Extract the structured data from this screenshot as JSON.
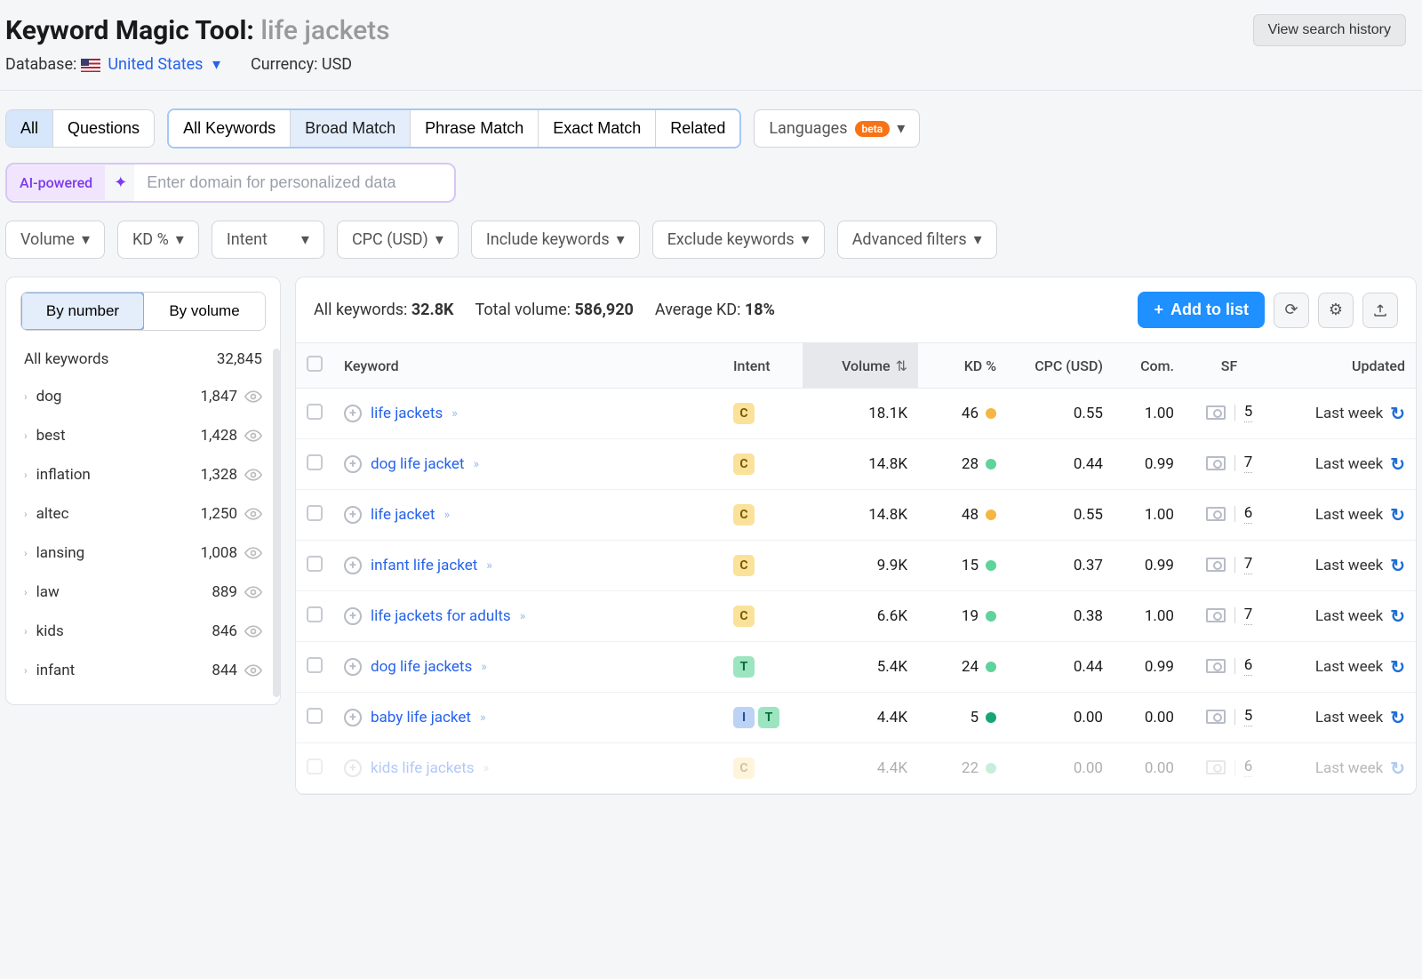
{
  "header": {
    "title_prefix": "Keyword Magic Tool:",
    "title_query": "life jackets",
    "view_history": "View search history",
    "database_label": "Database:",
    "database_value": "United States",
    "currency_label": "Currency: USD"
  },
  "tabs1": {
    "all": "All",
    "questions": "Questions",
    "all_kw": "All Keywords",
    "broad": "Broad Match",
    "phrase": "Phrase Match",
    "exact": "Exact Match",
    "related": "Related",
    "languages": "Languages",
    "beta": "beta"
  },
  "ai": {
    "label": "AI-powered",
    "placeholder": "Enter domain for personalized data"
  },
  "filters": {
    "volume": "Volume",
    "kd": "KD %",
    "intent": "Intent",
    "cpc": "CPC (USD)",
    "include": "Include keywords",
    "exclude": "Exclude keywords",
    "advanced": "Advanced filters"
  },
  "sidebar": {
    "by_number": "By number",
    "by_volume": "By volume",
    "all_label": "All keywords",
    "all_count": "32,845",
    "items": [
      {
        "name": "dog",
        "count": "1,847"
      },
      {
        "name": "best",
        "count": "1,428"
      },
      {
        "name": "inflation",
        "count": "1,328"
      },
      {
        "name": "altec",
        "count": "1,250"
      },
      {
        "name": "lansing",
        "count": "1,008"
      },
      {
        "name": "law",
        "count": "889"
      },
      {
        "name": "kids",
        "count": "846"
      },
      {
        "name": "infant",
        "count": "844"
      }
    ]
  },
  "results": {
    "stats": {
      "all_label": "All keywords:",
      "all_val": "32.8K",
      "vol_label": "Total volume:",
      "vol_val": "586,920",
      "kd_label": "Average KD:",
      "kd_val": "18%"
    },
    "add_to_list": "Add to list",
    "columns": {
      "keyword": "Keyword",
      "intent": "Intent",
      "volume": "Volume",
      "kd": "KD %",
      "cpc": "CPC (USD)",
      "com": "Com.",
      "sf": "SF",
      "updated": "Updated"
    },
    "rows": [
      {
        "kw": "life jackets",
        "intent": [
          "C"
        ],
        "vol": "18.1K",
        "kd": "46",
        "kd_color": "y",
        "cpc": "0.55",
        "com": "1.00",
        "sf": "5",
        "upd": "Last week"
      },
      {
        "kw": "dog life jacket",
        "intent": [
          "C"
        ],
        "vol": "14.8K",
        "kd": "28",
        "kd_color": "g",
        "cpc": "0.44",
        "com": "0.99",
        "sf": "7",
        "upd": "Last week"
      },
      {
        "kw": "life jacket",
        "intent": [
          "C"
        ],
        "vol": "14.8K",
        "kd": "48",
        "kd_color": "y",
        "cpc": "0.55",
        "com": "1.00",
        "sf": "6",
        "upd": "Last week"
      },
      {
        "kw": "infant life jacket",
        "intent": [
          "C"
        ],
        "vol": "9.9K",
        "kd": "15",
        "kd_color": "g",
        "cpc": "0.37",
        "com": "0.99",
        "sf": "7",
        "upd": "Last week"
      },
      {
        "kw": "life jackets for adults",
        "intent": [
          "C"
        ],
        "vol": "6.6K",
        "kd": "19",
        "kd_color": "g",
        "cpc": "0.38",
        "com": "1.00",
        "sf": "7",
        "upd": "Last week"
      },
      {
        "kw": "dog life jackets",
        "intent": [
          "T"
        ],
        "vol": "5.4K",
        "kd": "24",
        "kd_color": "g",
        "cpc": "0.44",
        "com": "0.99",
        "sf": "6",
        "upd": "Last week"
      },
      {
        "kw": "baby life jacket",
        "intent": [
          "I",
          "T"
        ],
        "vol": "4.4K",
        "kd": "5",
        "kd_color": "dg",
        "cpc": "0.00",
        "com": "0.00",
        "sf": "5",
        "upd": "Last week"
      },
      {
        "kw": "kids life jackets",
        "intent": [
          "C"
        ],
        "vol": "4.4K",
        "kd": "22",
        "kd_color": "g",
        "cpc": "0.00",
        "com": "0.00",
        "sf": "6",
        "upd": "Last week",
        "faded": true
      }
    ]
  }
}
